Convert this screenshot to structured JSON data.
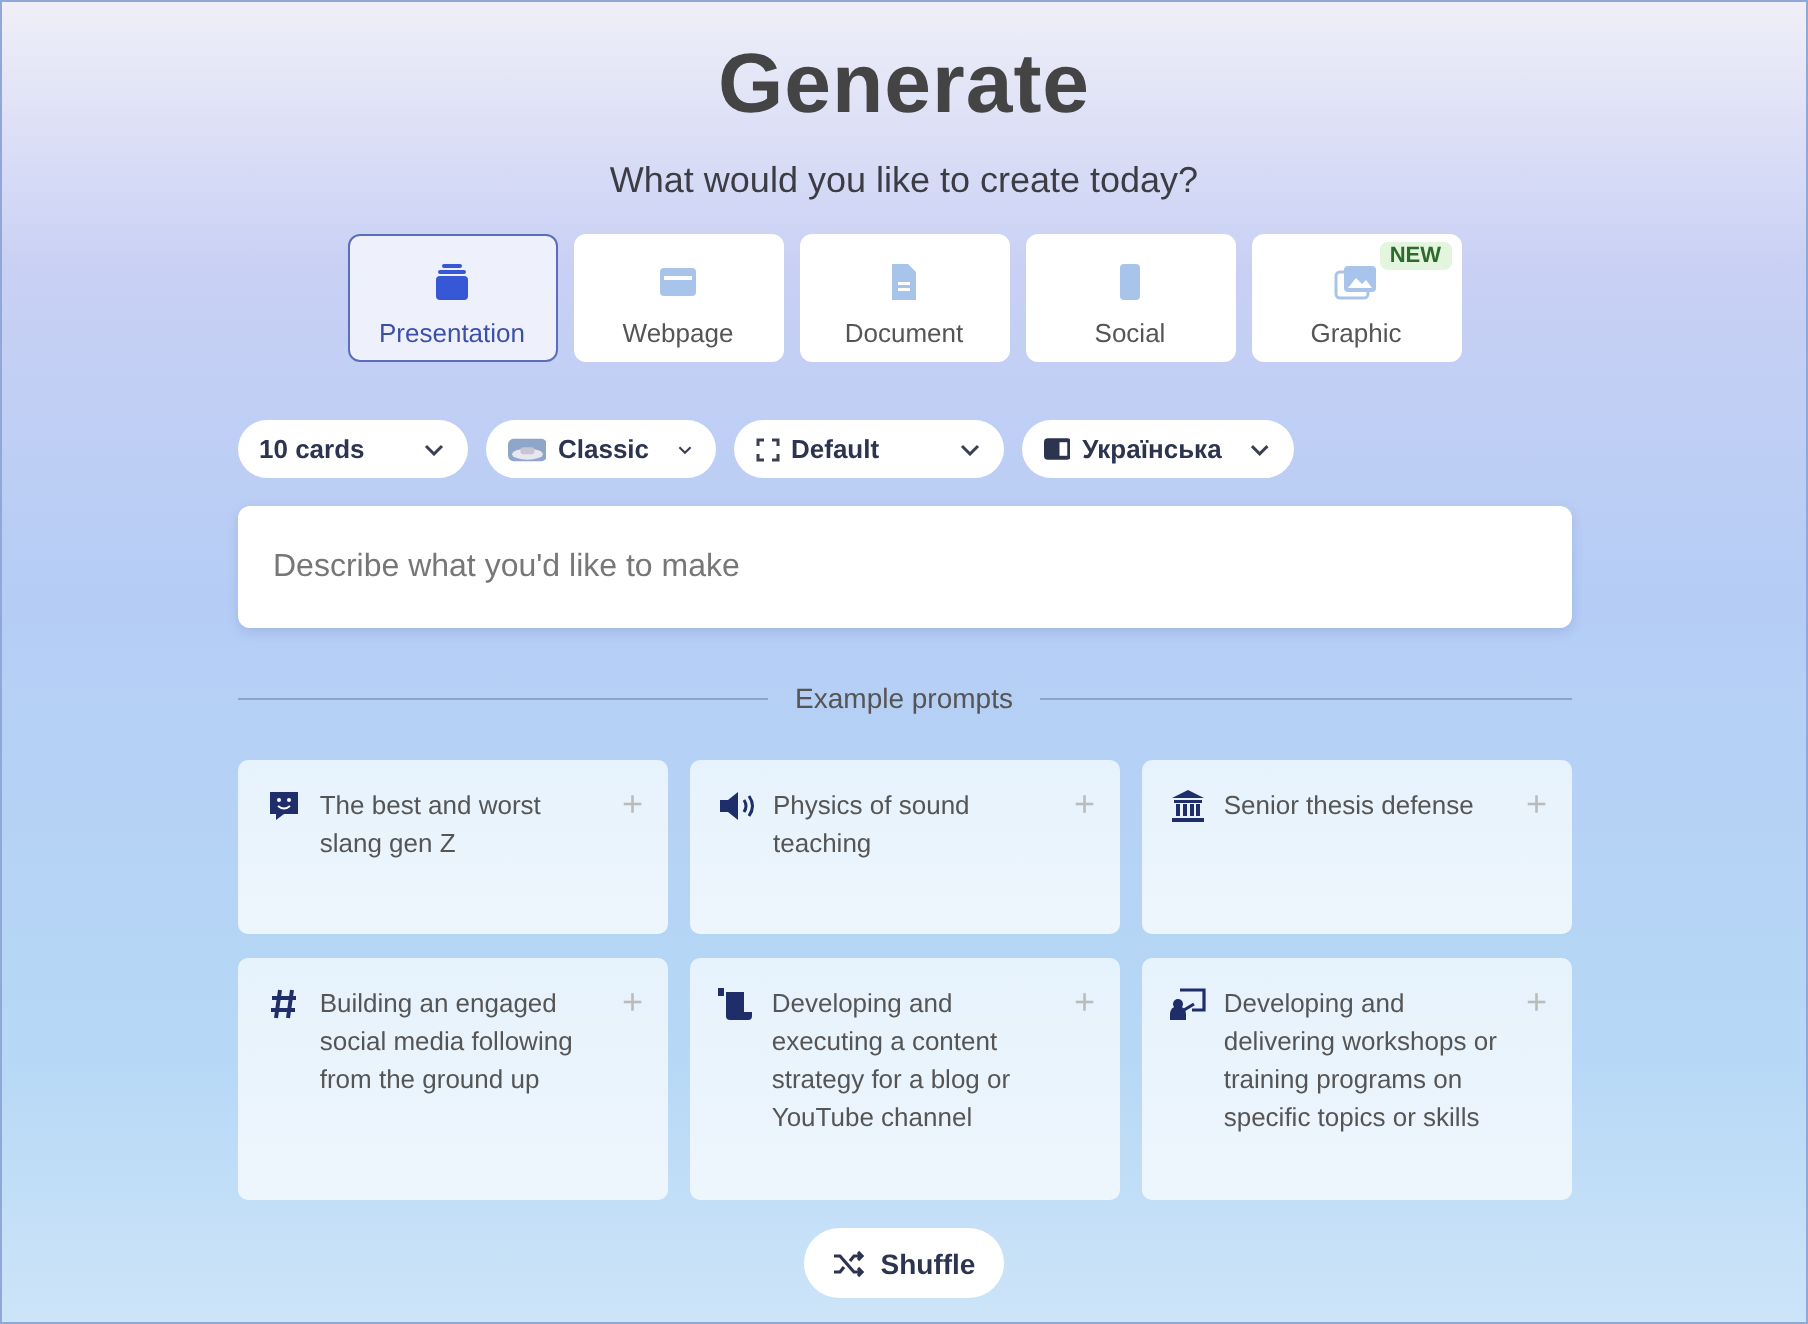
{
  "title": "Generate",
  "subtitle": "What would you like to create today?",
  "tabs": [
    {
      "label": "Presentation",
      "selected": true
    },
    {
      "label": "Webpage",
      "selected": false
    },
    {
      "label": "Document",
      "selected": false
    },
    {
      "label": "Social",
      "selected": false
    },
    {
      "label": "Graphic",
      "selected": false,
      "badge": "NEW"
    }
  ],
  "options": [
    {
      "label": "10 cards"
    },
    {
      "label": "Classic"
    },
    {
      "label": "Default"
    },
    {
      "label": "Українська"
    }
  ],
  "prompt": {
    "placeholder": "Describe what you'd like to make"
  },
  "examples_heading": "Example prompts",
  "examples": [
    {
      "text": "The best and worst slang gen Z",
      "action": "+"
    },
    {
      "text": "Physics of sound teaching",
      "action": "+"
    },
    {
      "text": "Senior thesis defense",
      "action": "+"
    },
    {
      "text": "Building an engaged social media following from the ground up",
      "action": "+"
    },
    {
      "text": "Developing and executing a content strategy for a blog or YouTube channel",
      "action": "+"
    },
    {
      "text": "Developing and delivering workshops or training programs on specific topics or skills",
      "action": "+"
    }
  ],
  "shuffle": {
    "label": "Shuffle"
  }
}
